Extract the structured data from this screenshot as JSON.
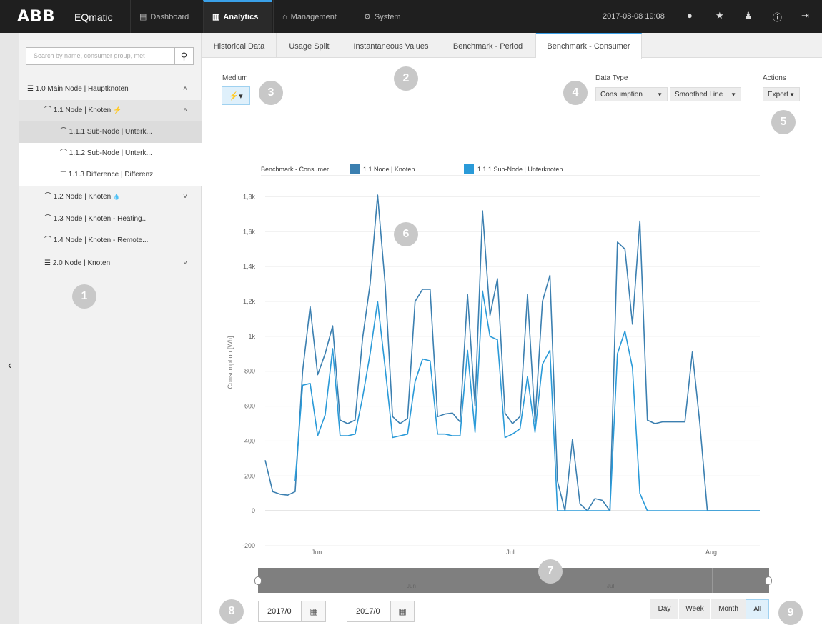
{
  "topbar": {
    "logo": "ABB",
    "app_name": "EQmatic",
    "nav": [
      {
        "label": "Dashboard",
        "icon": "▤"
      },
      {
        "label": "Analytics",
        "icon": "▥"
      },
      {
        "label": "Management",
        "icon": "⌂"
      },
      {
        "label": "System",
        "icon": "⚙"
      }
    ],
    "datetime": "2017-08-08 19:08",
    "icons": [
      "bell-icon",
      "star-icon",
      "user-icon",
      "info-icon",
      "logout-icon"
    ]
  },
  "sidebar": {
    "search_placeholder": "Search by name, consumer group, met",
    "items": [
      {
        "label": "1.0 Main Node | Hauptknoten",
        "icon": "☰",
        "chev": "˄"
      },
      {
        "label": "1.1 Node | Knoten",
        "icon": "⌒",
        "chev": "˄",
        "suffix": "⚡"
      },
      {
        "label": "1.1.1 Sub-Node | Unterk...",
        "icon": "⌒",
        "chev": ""
      },
      {
        "label": "1.1.2 Sub-Node | Unterk...",
        "icon": "⌒",
        "chev": ""
      },
      {
        "label": "1.1.3 Difference | Differenz",
        "icon": "☰",
        "chev": ""
      },
      {
        "label": "1.2 Node | Knoten",
        "icon": "⌒",
        "chev": "˅",
        "suffix": "💧"
      },
      {
        "label": "1.3 Node | Knoten - Heating...",
        "icon": "⌒",
        "chev": ""
      },
      {
        "label": "1.4 Node | Knoten - Remote...",
        "icon": "⌒",
        "chev": ""
      },
      {
        "label": "2.0 Node | Knoten",
        "icon": "☰",
        "chev": "˅"
      }
    ],
    "collapse_icon": "‹"
  },
  "tabs": [
    "Historical Data",
    "Usage Split",
    "Instantaneous Values",
    "Benchmark - Period",
    "Benchmark - Consumer"
  ],
  "controls": {
    "medium_label": "Medium",
    "medium_value": "⚡▾",
    "data_type_label": "Data Type",
    "data_type_value": "Consumption",
    "chart_style_value": "Smoothed Line",
    "actions_label": "Actions",
    "export_label": "Export"
  },
  "badges": [
    "1",
    "2",
    "3",
    "4",
    "5",
    "6",
    "7",
    "8",
    "9"
  ],
  "chart_data": {
    "type": "line",
    "title": "Benchmark - Consumer",
    "ylabel": "Consumption [Wh]",
    "ylim": [
      -200,
      1900
    ],
    "yticks": [
      "-200",
      "0",
      "200",
      "400",
      "600",
      "800",
      "1k",
      "1,2k",
      "1,4k",
      "1,6k",
      "1,8k"
    ],
    "xticks": [
      "Jun",
      "Jul",
      "Aug"
    ],
    "series": [
      {
        "name": "1.1 Node | Knoten",
        "color": "#3b7fb0",
        "values": [
          290,
          110,
          95,
          90,
          110,
          800,
          1170,
          780,
          900,
          1060,
          520,
          500,
          520,
          990,
          1300,
          1810,
          1300,
          540,
          500,
          530,
          1200,
          1270,
          1270,
          540,
          555,
          560,
          510,
          1240,
          600,
          1720,
          1120,
          1330,
          560,
          500,
          540,
          1240,
          510,
          1200,
          1350,
          170,
          0,
          410,
          40,
          0,
          70,
          60,
          0,
          1540,
          1500,
          1070,
          1660,
          520,
          500,
          510,
          510,
          510,
          510,
          910,
          500,
          0,
          0,
          0,
          0,
          0,
          0,
          0,
          0
        ]
      },
      {
        "name": "1.1.1 Sub-Node | Unterknoten",
        "color": "#2a9ad8",
        "values": [
          null,
          null,
          null,
          null,
          170,
          720,
          730,
          430,
          550,
          930,
          430,
          430,
          440,
          650,
          900,
          1200,
          820,
          420,
          430,
          440,
          740,
          870,
          860,
          440,
          440,
          430,
          430,
          920,
          450,
          1260,
          1000,
          980,
          420,
          440,
          470,
          770,
          450,
          840,
          920,
          0,
          0,
          0,
          0,
          0,
          0,
          0,
          0,
          900,
          1030,
          820,
          100,
          0,
          0,
          0,
          0,
          0,
          0,
          0,
          0,
          0,
          0,
          0,
          0,
          0,
          0,
          0,
          0
        ]
      }
    ]
  },
  "navigator": {
    "labels": [
      "Jun",
      "Jul"
    ]
  },
  "dates": {
    "from": "2017/0",
    "to": "2017/0"
  },
  "ranges": [
    "Day",
    "Week",
    "Month",
    "All"
  ]
}
